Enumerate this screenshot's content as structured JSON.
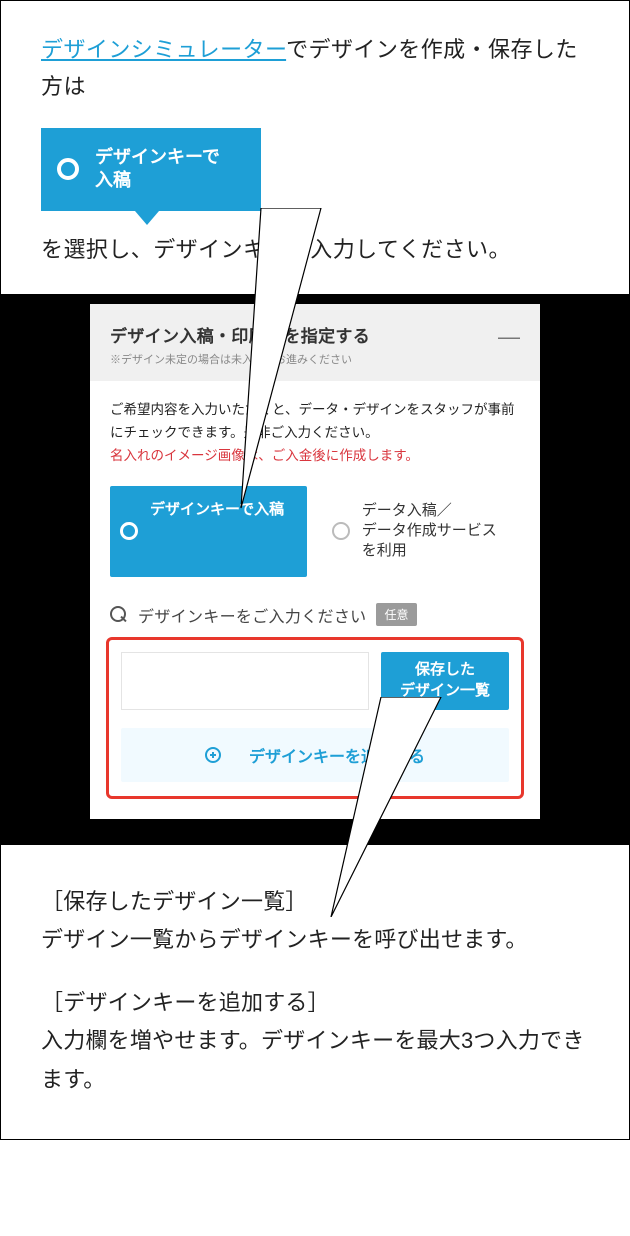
{
  "top": {
    "link_text": "デザインシミュレーター",
    "text_after_link": "でデザインを作成・保存した方は",
    "button_label": "デザインキーで\n入稿",
    "text_below_button": "を選択し、デザインキーを入力してください。"
  },
  "panel": {
    "title": "デザイン入稿・印刷色を指定する",
    "subtitle": "※デザイン未定の場合は未入力でお進みください",
    "collapse_label": "—",
    "body_line1": "ご希望内容を入力いただくと、データ・デザインをスタッフが事前にチェックできます。是非ご入力ください。",
    "body_line2_red": "名入れのイメージ画像は、ご入金後に作成します。",
    "options": {
      "selected": "デザインキーで入稿",
      "other": "データ入稿／\nデータ作成サービスを利用"
    },
    "input_section": {
      "label": "デザインキーをご入力ください",
      "badge": "任意",
      "placeholder": "",
      "saved_button": "保存した\nデザイン一覧",
      "add_button": "デザインキーを追加する"
    }
  },
  "bottom": {
    "group1_title": "［保存したデザイン一覧］",
    "group1_body": "デザイン一覧からデザインキーを呼び出せます。",
    "group2_title": "［デザインキーを追加する］",
    "group2_body": "入力欄を増やせます。デザインキーを最大3つ入力できます。"
  }
}
